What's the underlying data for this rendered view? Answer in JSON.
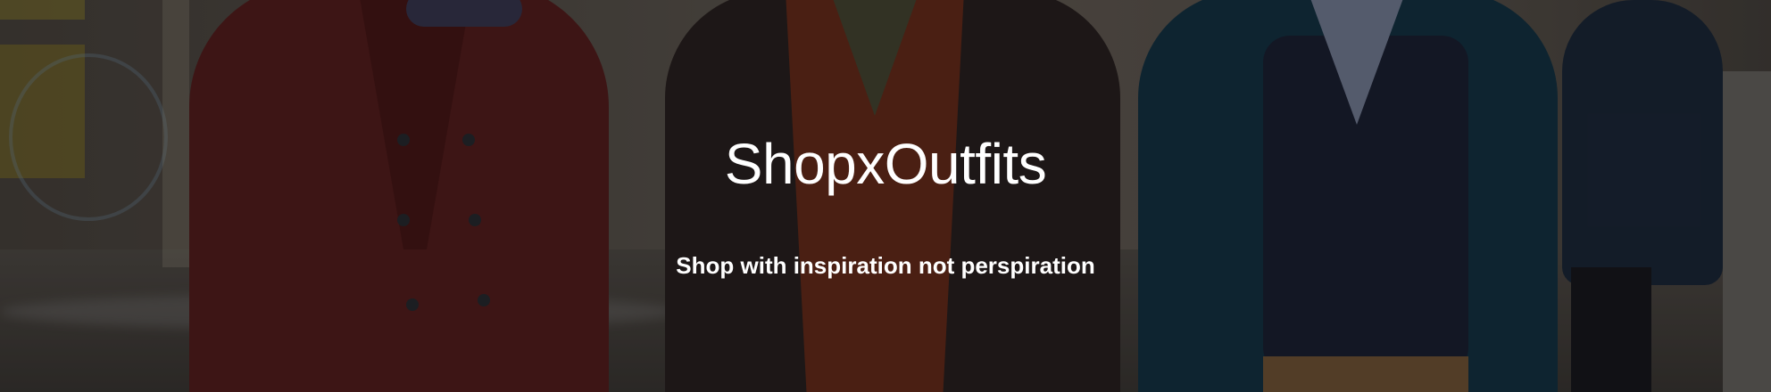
{
  "hero": {
    "title": "ShopxOutfits",
    "tagline": "Shop with inspiration not perspiration",
    "background_photo": "street-style-people-walking-in-winter-coats",
    "overlay_color": "#000000"
  }
}
